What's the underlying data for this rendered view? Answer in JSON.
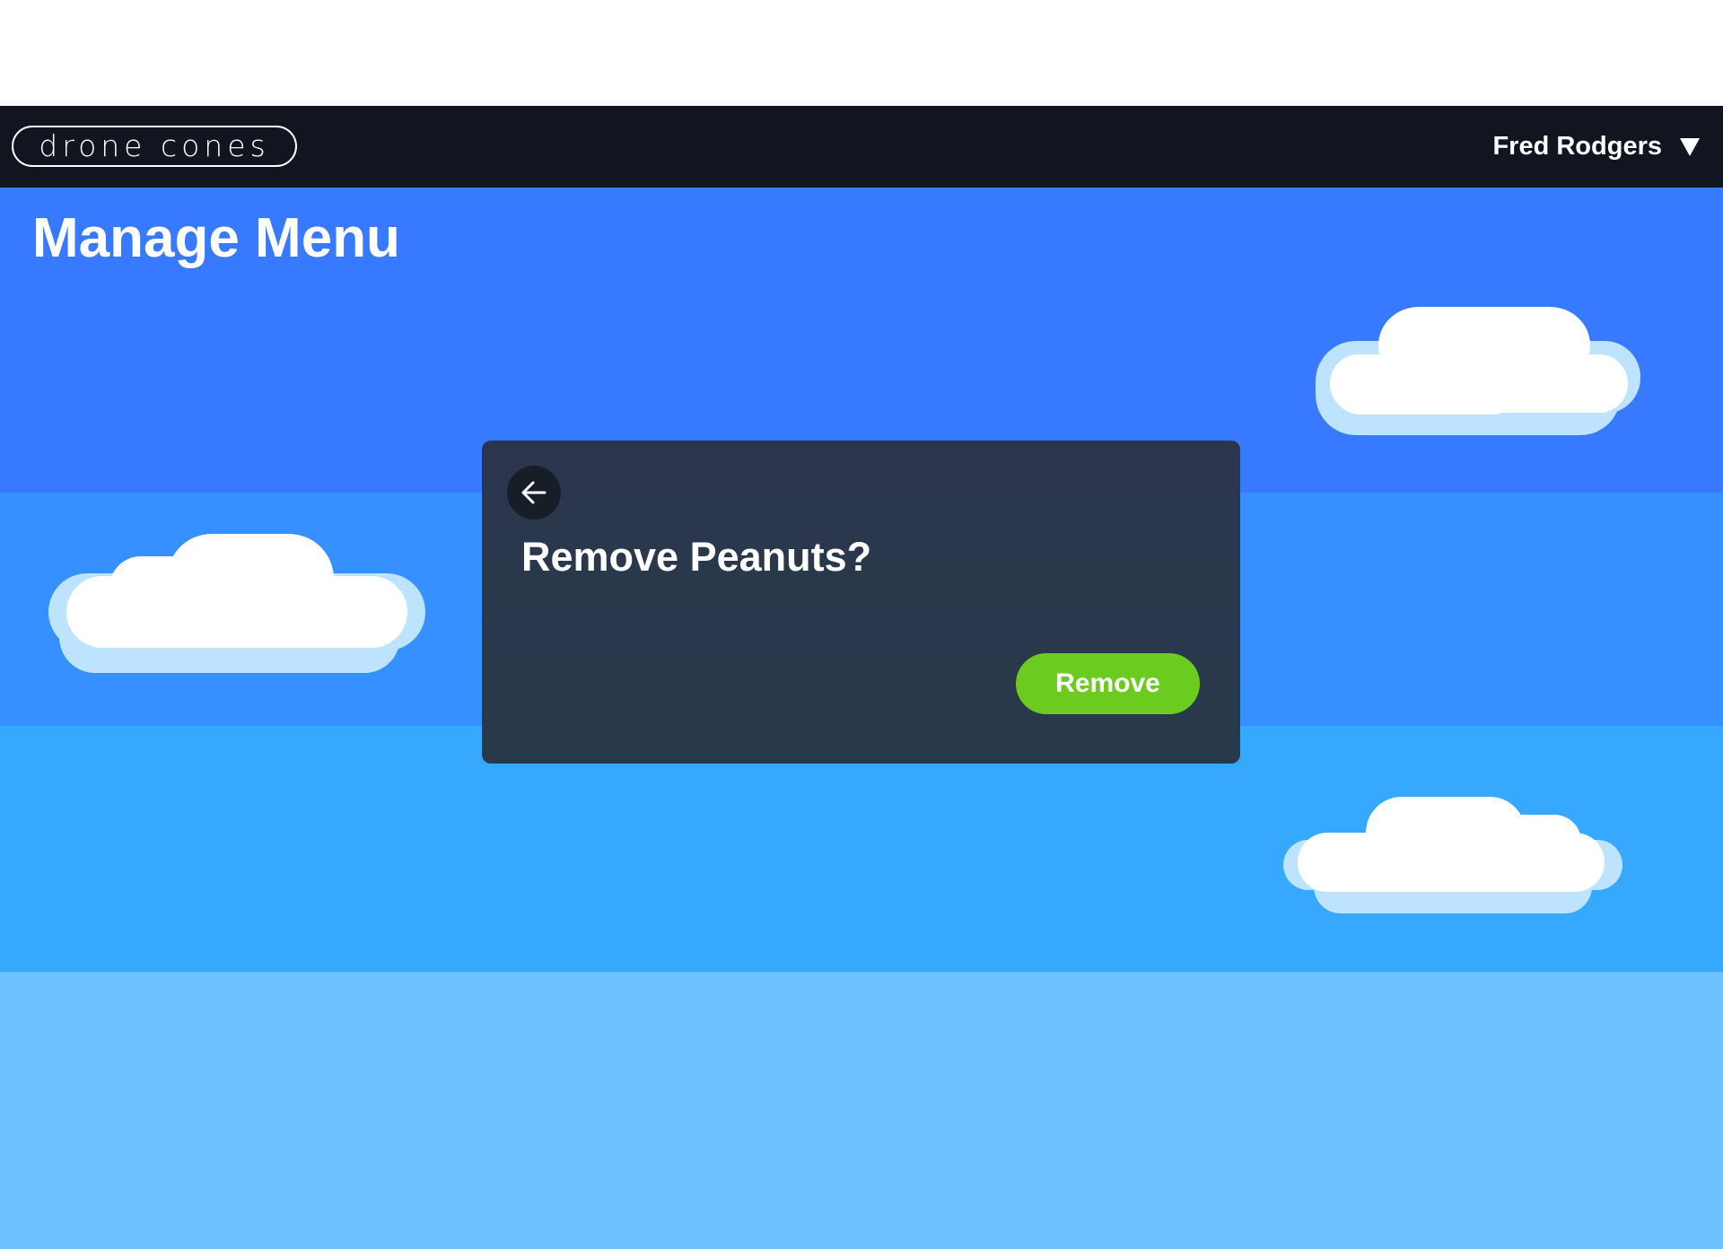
{
  "navbar": {
    "logo_text": "drone cones",
    "user_name": "Fred Rodgers",
    "user_menu_icon": "caret-down-icon"
  },
  "page": {
    "title": "Manage Menu"
  },
  "modal": {
    "back_icon": "arrow-left-icon",
    "title": "Remove Peanuts?",
    "remove_label": "Remove"
  },
  "colors": {
    "navbar": "#10151f",
    "sky_band_1": "#387aff",
    "sky_band_2": "#3690ff",
    "sky_band_3": "#36a9fe",
    "sky_band_4": "#6cc2fe",
    "modal_background": "#2b364e",
    "remove_button": "#6ccb1f",
    "cloud": "#ffffff",
    "cloud_shadow": "#bde3ff"
  }
}
